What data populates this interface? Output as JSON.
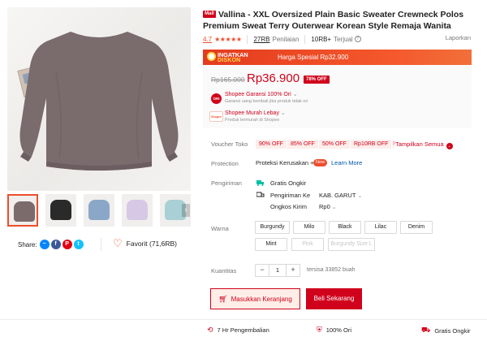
{
  "product": {
    "mall_badge": "Mall",
    "title": "Vallina - XXL Oversized Plain Basic Sweater Crewneck Polos Premium Sweat Terry Outerwear Korean Style Remaja Wanita",
    "rating": "4.7",
    "stars": "★★★★★",
    "reviews_count": "27RB",
    "reviews_label": "Penilaian",
    "sold_count": "10RB+",
    "sold_label": "Terjual",
    "report_label": "Laporkan"
  },
  "flash": {
    "logo_line1": "INGATKAN",
    "logo_line2": "DISKON",
    "special_price": "Harga Spesial Rp32.900"
  },
  "price": {
    "original": "Rp165.000",
    "current": "Rp36.900",
    "discount": "78% OFF"
  },
  "guarantees": [
    {
      "icon": "ORI",
      "title": "Shopee Garansi 100% Ori",
      "subtitle": "Garansi uang kembali jika produk tidak ori"
    },
    {
      "icon": "Shopee",
      "title": "Shopee Murah Lebay",
      "subtitle": "Produk termurah di Shopee"
    }
  ],
  "voucher": {
    "label": "Voucher Toko",
    "items": [
      "90% OFF",
      "85% OFF",
      "50% OFF",
      "Rp10RB OFF",
      "Rp"
    ],
    "show_all": "Tampilkan Semua"
  },
  "protection": {
    "label": "Protection",
    "value": "Proteksi Kerusakan +",
    "badge": "New",
    "link": "Learn More"
  },
  "shipping": {
    "label": "Pengiriman",
    "free": "Gratis Ongkir",
    "to_label": "Pengiriman Ke",
    "to_value": "KAB. GARUT",
    "cost_label": "Ongkos Kirim",
    "cost_value": "Rp0"
  },
  "color": {
    "label": "Warna",
    "options": [
      "Burgundy",
      "Milo",
      "Black",
      "Lilac",
      "Denim",
      "Mint",
      "Pink",
      "Burgundy Size L"
    ]
  },
  "quantity": {
    "label": "Kuantitas",
    "minus": "−",
    "value": "1",
    "plus": "+",
    "stock": "tersisa 33852 buah"
  },
  "actions": {
    "add_to_cart": "Masukkan Keranjang",
    "buy_now": "Beli Sekarang"
  },
  "share": {
    "label": "Share:",
    "favorite": "Favorit (71,6RB)"
  },
  "footer": {
    "return": "7 Hr Pengembalian",
    "ori": "100% Ori",
    "free_ship": "Gratis Ongkir"
  },
  "thumbnails": [
    {
      "color": "#7b6b6b",
      "label": "burgundy-thumbnail"
    },
    {
      "color": "#2a2a2a",
      "label": "black-thumbnail"
    },
    {
      "color": "#8aa7c7",
      "label": "denim-thumbnail"
    },
    {
      "color": "#d7c8e6",
      "label": "lilac-thumbnail"
    },
    {
      "color": "#a9d0d4",
      "label": "mint-thumbnail"
    }
  ],
  "colors": {
    "accent": "#d0011b",
    "shopee_orange": "#ee4d2d",
    "sweater": "#7a6b6d"
  }
}
